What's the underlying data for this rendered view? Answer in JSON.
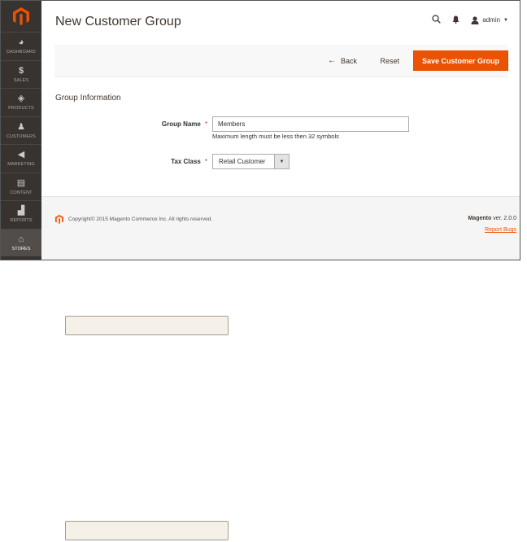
{
  "nav": {
    "items": [
      {
        "label": "DASHBOARD",
        "icon": "dashboard-icon"
      },
      {
        "label": "SALES",
        "icon": "dollar-icon"
      },
      {
        "label": "PRODUCTS",
        "icon": "box-icon"
      },
      {
        "label": "CUSTOMERS",
        "icon": "person-icon"
      },
      {
        "label": "MARKETING",
        "icon": "megaphone-icon"
      },
      {
        "label": "CONTENT",
        "icon": "content-icon"
      },
      {
        "label": "REPORTS",
        "icon": "bar-chart-icon"
      },
      {
        "label": "STORES",
        "icon": "store-icon"
      }
    ]
  },
  "header": {
    "title": "New Customer Group",
    "user": "admin"
  },
  "actions": {
    "back": "Back",
    "reset": "Reset",
    "save": "Save Customer Group"
  },
  "form": {
    "section_title": "Group Information",
    "group_name_label": "Group Name",
    "group_name_value": "Members",
    "group_name_note": "Maximum length must be less then 32 symbols",
    "tax_class_label": "Tax Class",
    "tax_class_value": "Retail Customer",
    "required_mark": "*"
  },
  "footer": {
    "copyright": "Copyright© 2015 Magento Commerce Inc. All rights reserved.",
    "brand": "Magento",
    "version": "ver. 2.0.0",
    "report_bugs": "Report Bugs"
  },
  "colors": {
    "accent": "#eb5202",
    "nav_bg": "#373330"
  }
}
